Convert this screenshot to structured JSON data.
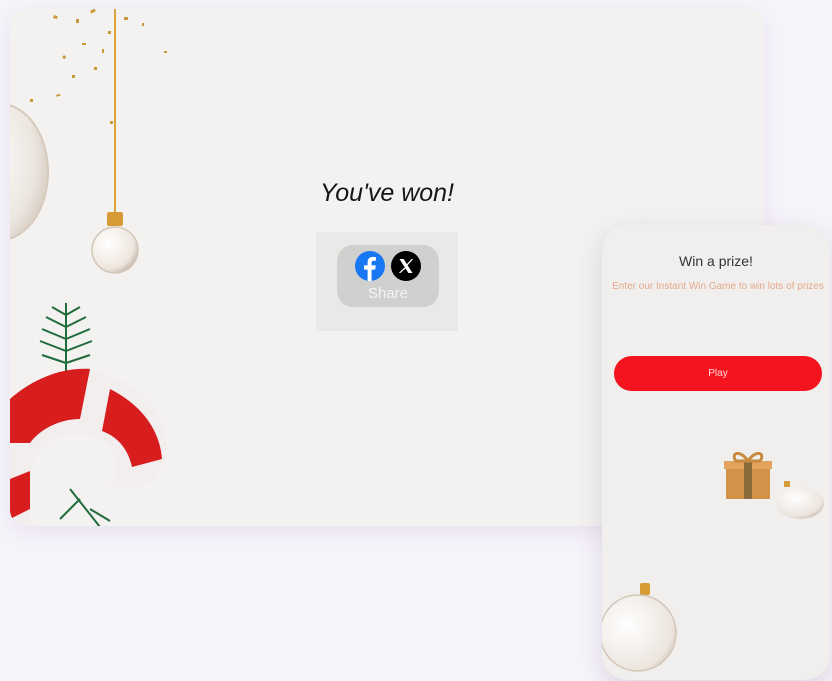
{
  "desktop": {
    "title": "You've won!",
    "share": {
      "label": "Share",
      "networks": [
        "facebook-icon",
        "x-icon"
      ]
    }
  },
  "mobile": {
    "title": "Win a prize!",
    "subtitle": "Enter our Instant Win Game to win lots of prizes",
    "play_label": "Play"
  },
  "colors": {
    "background": "#f7f4fb",
    "card": "#f3f2f0",
    "play_button": "#f3141f",
    "subtitle_text": "#e3a989",
    "facebook": "#1877f2",
    "x": "#000000"
  }
}
